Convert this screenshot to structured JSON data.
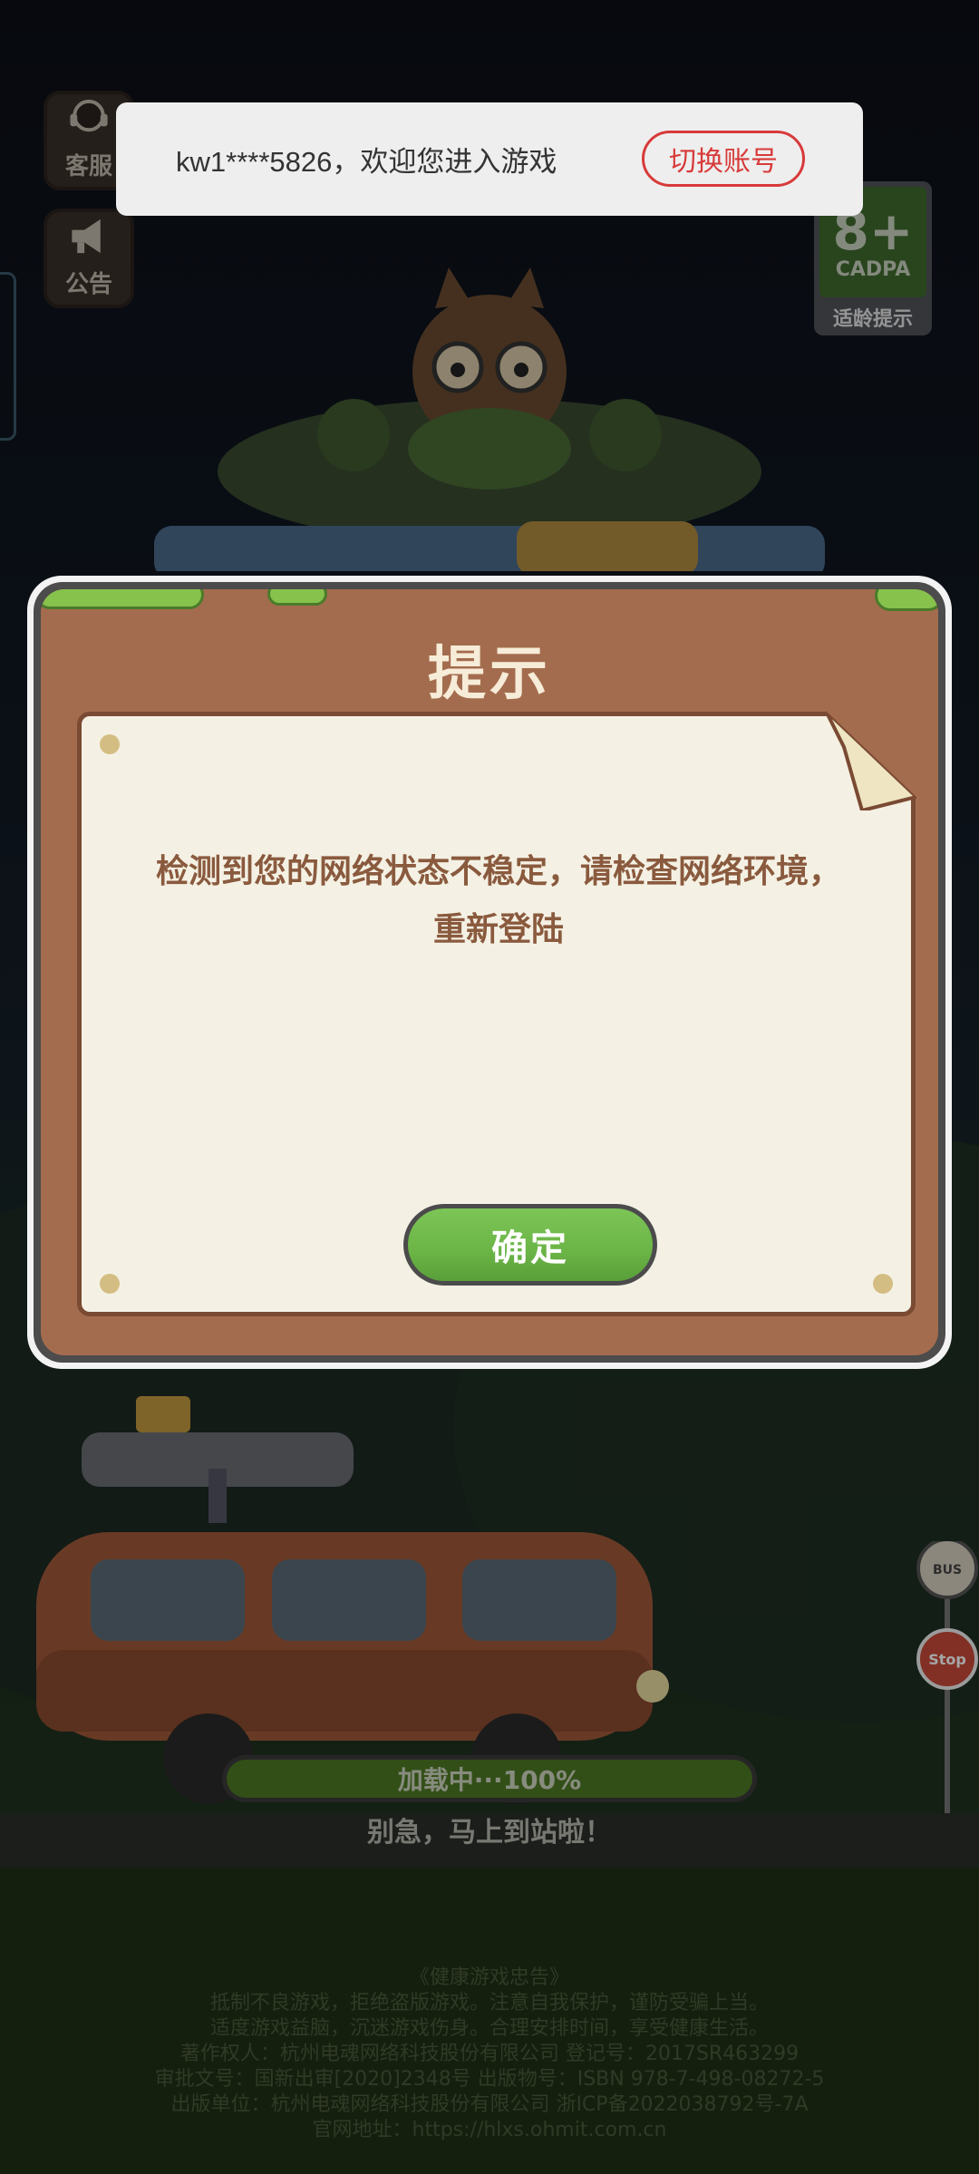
{
  "toast": {
    "message": "kw1****5826，欢迎您进入游戏",
    "switch_label": "切换账号"
  },
  "side_buttons": {
    "service_label": "客服",
    "notice_label": "公告"
  },
  "age_badge": {
    "rating": "8+",
    "org": "CADPA",
    "note": "适龄提示"
  },
  "dialog": {
    "title": "提示",
    "message": "检测到您的网络状态不稳定，请检查网络环境，重新登陆",
    "confirm_label": "确定"
  },
  "loading": {
    "text": "加载中···100%",
    "progress": 1.0,
    "hint": "别急，马上到站啦！"
  },
  "bus_stop": {
    "bus_text": "BUS",
    "stop_text": "Stop"
  },
  "footer": {
    "lines": [
      "《健康游戏忠告》",
      "抵制不良游戏，拒绝盗版游戏。注意自我保护，谨防受骗上当。",
      "适度游戏益脑，沉迷游戏伤身。合理安排时间，享受健康生活。",
      "著作权人：杭州电魂网络科技股份有限公司 登记号：2017SR463299",
      "审批文号：国新出审[2020]2348号 出版物号：ISBN 978-7-498-08272-5",
      "出版单位：杭州电魂网络科技股份有限公司 浙ICP备2022038792号-7A",
      "官网地址：https://hlxs.ohmit.com.cn"
    ]
  },
  "colors": {
    "accent_red": "#d83a3a",
    "confirm_green": "#6bb446",
    "wood_brown": "#a46c4e",
    "message_brown": "#8a5a3e"
  }
}
